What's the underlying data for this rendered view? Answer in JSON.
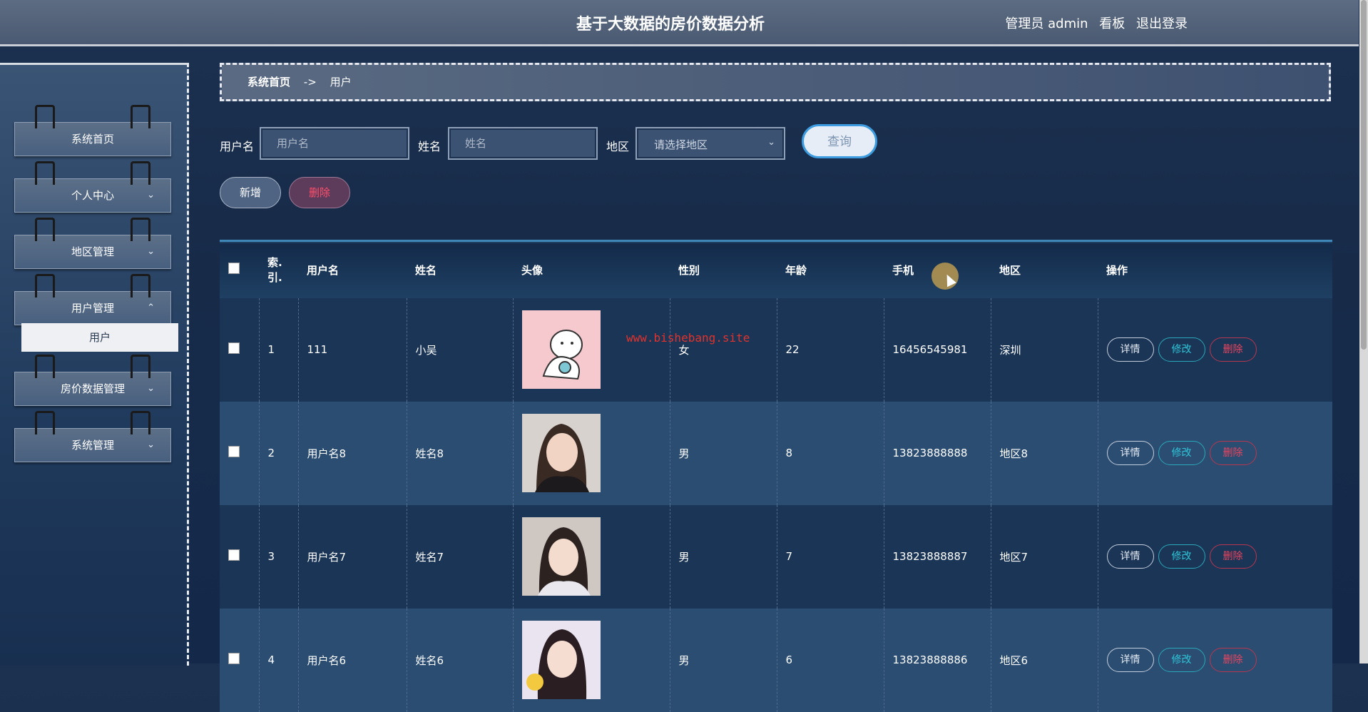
{
  "header": {
    "title": "基于大数据的房价数据分析",
    "admin_label": "管理员 admin",
    "board_label": "看板",
    "logout_label": "退出登录"
  },
  "sidebar": {
    "items": [
      {
        "label": "系统首页",
        "chevron": ""
      },
      {
        "label": "个人中心",
        "chevron": "⌄"
      },
      {
        "label": "地区管理",
        "chevron": "⌄"
      },
      {
        "label": "用户管理",
        "chevron": "⌃"
      },
      {
        "label": "房价数据管理",
        "chevron": "⌄"
      },
      {
        "label": "系统管理",
        "chevron": "⌄"
      }
    ],
    "sub_item": "用户"
  },
  "breadcrumb": {
    "home": "系统首页",
    "separator": "->",
    "current": "用户"
  },
  "search": {
    "username_label": "用户名",
    "username_placeholder": "用户名",
    "name_label": "姓名",
    "name_placeholder": "姓名",
    "region_label": "地区",
    "region_placeholder": "请选择地区",
    "query_button": "查询"
  },
  "actions": {
    "add": "新增",
    "delete": "删除"
  },
  "table": {
    "columns": [
      "索引",
      "用户名",
      "姓名",
      "头像",
      "性别",
      "年龄",
      "手机",
      "地区",
      "操作"
    ],
    "index_header_line1": "索.",
    "index_header_line2": "引.",
    "rows": [
      {
        "index": "1",
        "username": "111",
        "name": "小吴",
        "avatar": "cartoon-cat-avatar",
        "gender": "女",
        "age": "22",
        "phone": "16456545981",
        "region": "深圳"
      },
      {
        "index": "2",
        "username": "用户名8",
        "name": "姓名8",
        "avatar": "portrait-photo",
        "gender": "男",
        "age": "8",
        "phone": "13823888888",
        "region": "地区8"
      },
      {
        "index": "3",
        "username": "用户名7",
        "name": "姓名7",
        "avatar": "portrait-photo",
        "gender": "男",
        "age": "7",
        "phone": "13823888887",
        "region": "地区7"
      },
      {
        "index": "4",
        "username": "用户名6",
        "name": "姓名6",
        "avatar": "portrait-photo",
        "gender": "男",
        "age": "6",
        "phone": "13823888886",
        "region": "地区6"
      }
    ],
    "row_actions": {
      "detail": "详情",
      "edit": "修改",
      "remove": "删除"
    }
  },
  "watermark": "www.bishebang.site",
  "colors": {
    "accent": "#3d9be0",
    "danger": "#e8445f",
    "edit": "#2ec5d8",
    "header_bg": "#4a5a72",
    "content_bg": "#172b49"
  }
}
